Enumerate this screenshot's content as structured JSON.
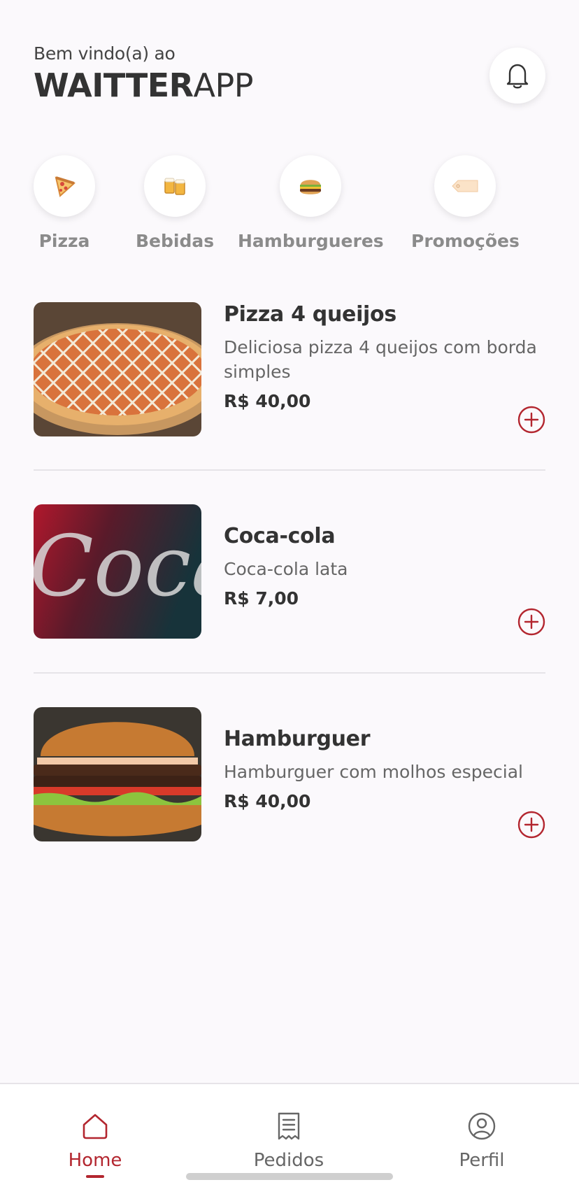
{
  "header": {
    "welcome": "Bem vindo(a) ao",
    "brand_bold": "WAITTER",
    "brand_light": "APP"
  },
  "notifications": {
    "icon": "bell-icon"
  },
  "categories": [
    {
      "label": "Pizza",
      "icon": "pizza-icon"
    },
    {
      "label": "Bebidas",
      "icon": "beer-icon"
    },
    {
      "label": "Hamburgueres",
      "icon": "hamburger-icon"
    },
    {
      "label": "Promoções",
      "icon": "tag-icon"
    }
  ],
  "products": [
    {
      "name": "Pizza 4 queijos",
      "description": "Deliciosa pizza 4 queijos com borda simples",
      "price": "R$ 40,00",
      "image": "pizza-photo"
    },
    {
      "name": "Coca-cola",
      "description": "Coca-cola lata",
      "price": "R$ 7,00",
      "image": "coca-cola-photo"
    },
    {
      "name": "Hamburguer",
      "description": "Hamburguer com molhos especial",
      "price": "R$ 40,00",
      "image": "hamburger-photo"
    }
  ],
  "nav": {
    "items": [
      {
        "label": "Home",
        "icon": "home-icon",
        "active": true
      },
      {
        "label": "Pedidos",
        "icon": "receipt-icon",
        "active": false
      },
      {
        "label": "Perfil",
        "icon": "profile-icon",
        "active": false
      }
    ]
  },
  "colors": {
    "accent": "#b3262f",
    "background": "#fbf9fc",
    "text": "#333333",
    "muted": "#666666"
  }
}
